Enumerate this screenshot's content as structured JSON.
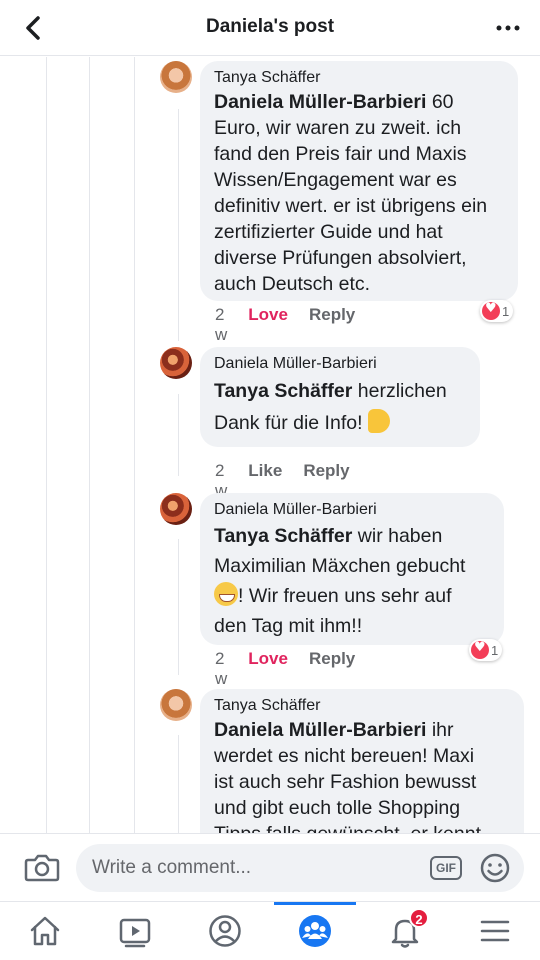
{
  "header": {
    "title": "Daniela's post",
    "back_icon": "chevron-left-icon",
    "more_icon": "ellipsis-icon"
  },
  "comments": [
    {
      "author": "Tanya Schäffer",
      "mention": "Daniela Müller-Barbieri",
      "text": " 60 Euro, wir waren zu zweit. ich fand den Preis fair und Maxis Wissen/Engagement war es definitiv wert. er ist übrigens ein zertifizierter Guide und hat diverse Prüfungen absolviert, auch Deutsch etc.",
      "time": "2 w",
      "like_label": "Love",
      "reply_label": "Reply",
      "reaction_count": "1"
    },
    {
      "author": "Daniela Müller-Barbieri",
      "mention": "Tanya Schäffer",
      "text_line1": " herzlichen",
      "text_line2": "Dank für die Info! ",
      "time": "2 w",
      "like_label": "Like",
      "reply_label": "Reply"
    },
    {
      "author": "Daniela Müller-Barbieri",
      "mention": "Tanya Schäffer",
      "text_line1": " wir haben",
      "text_line2": "Maximilian Mäxchen gebucht",
      "text_line3": "! Wir freuen uns sehr auf",
      "text_line4": "den Tag mit ihm!!",
      "time": "2 w",
      "like_label": "Love",
      "reply_label": "Reply",
      "reaction_count": "1"
    },
    {
      "author": "Tanya Schäffer",
      "mention": "Daniela Müller-Barbieri",
      "text_line1": " ihr",
      "text_line2": "werdet es nicht bereuen! Maxi",
      "text_line3": "ist auch sehr Fashion  bewusst",
      "text_line4": "und gibt euch tolle Shopping",
      "text_line5": "Tipps falls gewünscht, er kennt"
    }
  ],
  "composer": {
    "placeholder": "Write a comment...",
    "gif_label": "GIF"
  },
  "tabbar": {
    "notifications_badge": "2",
    "active_tab": "groups"
  },
  "colors": {
    "accent": "#1877f2",
    "love": "#e0245e",
    "bubble": "#f0f2f5",
    "badge": "#e41e3f"
  }
}
